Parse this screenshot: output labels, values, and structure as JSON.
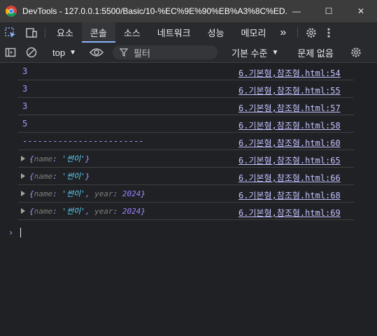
{
  "window": {
    "title": "DevTools - 127.0.0.1:5500/Basic/10-%EC%9E%90%EB%A3%8C%ED...",
    "minimize": "—",
    "maximize": "☐",
    "close": "✕"
  },
  "tabs": {
    "items": [
      "요소",
      "콘솔",
      "소스",
      "네트워크",
      "성능",
      "메모리"
    ],
    "more": "»"
  },
  "toolbar": {
    "context": "top",
    "filter_placeholder": "필터",
    "levels": "기본 수준",
    "issues": "문제 없음"
  },
  "console": {
    "rows": [
      {
        "type": "number",
        "value": "3",
        "source": "6.기본형,참조형.html:54"
      },
      {
        "type": "number",
        "value": "3",
        "source": "6.기본형,참조형.html:55"
      },
      {
        "type": "number",
        "value": "3",
        "source": "6.기본형,참조형.html:57"
      },
      {
        "type": "number",
        "value": "5",
        "source": "6.기본형,참조형.html:58"
      },
      {
        "type": "text",
        "value": "------------------------",
        "source": "6.기본형,참조형.html:60"
      },
      {
        "type": "object",
        "name_key": "name",
        "name_val": "'썬이'",
        "source": "6.기본형,참조형.html:65"
      },
      {
        "type": "object",
        "name_key": "name",
        "name_val": "'썬이'",
        "source": "6.기본형,참조형.html:66"
      },
      {
        "type": "object",
        "name_key": "name",
        "name_val": "'썬이'",
        "year_key": "year",
        "year_val": "2024",
        "source": "6.기본형,참조형.html:68"
      },
      {
        "type": "object",
        "name_key": "name",
        "name_val": "'썬이'",
        "year_key": "year",
        "year_val": "2024",
        "source": "6.기본형,참조형.html:69"
      }
    ],
    "prompt": "›"
  }
}
